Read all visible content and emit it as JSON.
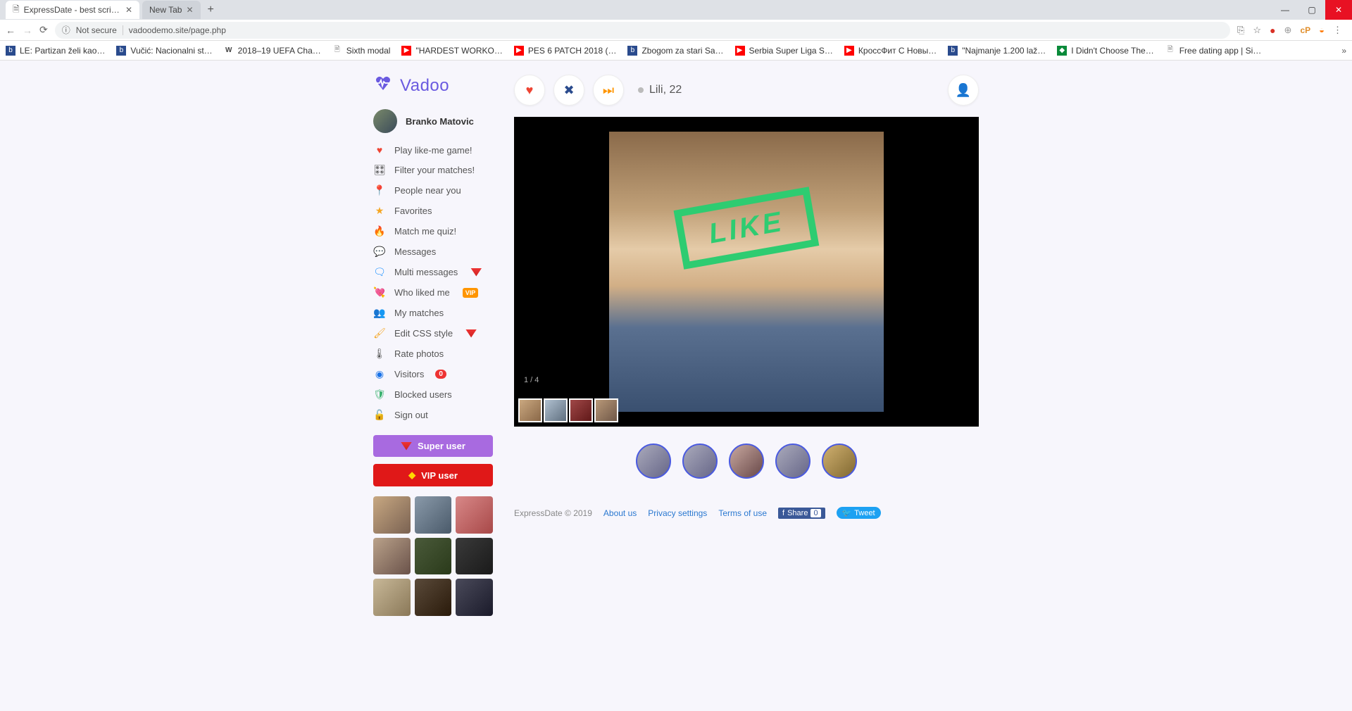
{
  "browser": {
    "tabs": [
      {
        "title": "ExpressDate - best script for mak"
      },
      {
        "title": "New Tab"
      }
    ],
    "not_secure": "Not secure",
    "url": "vadoodemo.site/page.php",
    "bookmarks": [
      "LE: Partizan želi kao…",
      "Vučić: Nacionalni st…",
      "2018–19 UEFA Cha…",
      "Sixth modal",
      "\"HARDEST WORKO…",
      "PES 6 PATCH 2018 (…",
      "Zbogom za stari Sa…",
      "Serbia Super Liga S…",
      "КроссФит С Новы…",
      "\"Najmanje 1.200 laž…",
      "I Didn't Choose The…",
      "Free dating app | Si…"
    ],
    "more": "»"
  },
  "brand": {
    "name": "Vadoo"
  },
  "user": {
    "name": "Branko Matovic"
  },
  "nav": {
    "play": "Play like-me game!",
    "filter": "Filter your matches!",
    "near": "People near you",
    "fav": "Favorites",
    "quiz": "Match me quiz!",
    "msgs": "Messages",
    "mmsgs": "Multi messages",
    "liked": "Who liked me",
    "matches": "My matches",
    "css": "Edit CSS style",
    "rate": "Rate photos",
    "visitors": "Visitors",
    "visitors_count": "0",
    "blocked": "Blocked users",
    "signout": "Sign out",
    "vip_label": "VIP"
  },
  "buttons": {
    "super": "Super user",
    "vip": "VIP user"
  },
  "card": {
    "name_age": "Lili, 22",
    "like_stamp": "LIKE",
    "counter": "1 / 4"
  },
  "footer": {
    "copy": "ExpressDate © 2019",
    "about": "About us",
    "privacy": "Privacy settings",
    "terms": "Terms of use",
    "share_label": "Share",
    "share_count": "0",
    "tweet": "Tweet"
  }
}
